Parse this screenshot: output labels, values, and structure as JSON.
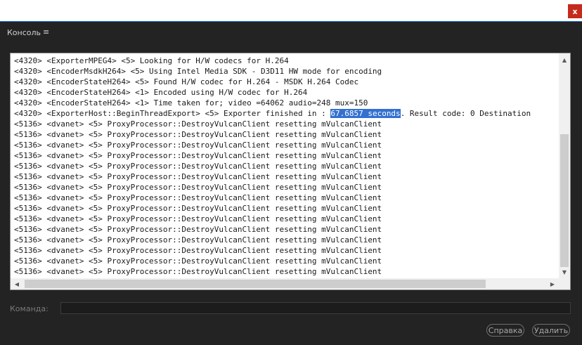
{
  "window": {
    "close_label": "x"
  },
  "panel": {
    "title": "Консоль",
    "menu_icon": "≡"
  },
  "console": {
    "lines": [
      "<4320> <ExporterMPEG4> <5> Looking for H/W codecs for H.264",
      "<4320> <EncoderMsdkH264> <5> Using Intel Media SDK - D3D11 HW mode for encoding",
      "<4320> <EncoderStateH264> <5> Found H/W codec for H.264 - MSDK H.264 Codec",
      "<4320> <EncoderStateH264> <1> Encoded using H/W codec for H.264",
      "<4320> <EncoderStateH264> <1> Time taken for; video =64062 audio=248 mux=150",
      "<4320> <ExporterHost::BeginThreadExport> <5> Exporter finished in : 67.6857 seconds. Result code: 0 Destination",
      "<5136> <dvanet> <5> ProxyProcessor::DestroyVulcanClient resetting mVulcanClient",
      "<5136> <dvanet> <5> ProxyProcessor::DestroyVulcanClient resetting mVulcanClient",
      "<5136> <dvanet> <5> ProxyProcessor::DestroyVulcanClient resetting mVulcanClient",
      "<5136> <dvanet> <5> ProxyProcessor::DestroyVulcanClient resetting mVulcanClient",
      "<5136> <dvanet> <5> ProxyProcessor::DestroyVulcanClient resetting mVulcanClient",
      "<5136> <dvanet> <5> ProxyProcessor::DestroyVulcanClient resetting mVulcanClient",
      "<5136> <dvanet> <5> ProxyProcessor::DestroyVulcanClient resetting mVulcanClient",
      "<5136> <dvanet> <5> ProxyProcessor::DestroyVulcanClient resetting mVulcanClient",
      "<5136> <dvanet> <5> ProxyProcessor::DestroyVulcanClient resetting mVulcanClient",
      "<5136> <dvanet> <5> ProxyProcessor::DestroyVulcanClient resetting mVulcanClient",
      "<5136> <dvanet> <5> ProxyProcessor::DestroyVulcanClient resetting mVulcanClient",
      "<5136> <dvanet> <5> ProxyProcessor::DestroyVulcanClient resetting mVulcanClient",
      "<5136> <dvanet> <5> ProxyProcessor::DestroyVulcanClient resetting mVulcanClient",
      "<5136> <dvanet> <5> ProxyProcessor::DestroyVulcanClient resetting mVulcanClient",
      "<5136> <dvanet> <5> ProxyProcessor::DestroyVulcanClient resetting mVulcanClient"
    ],
    "selection": {
      "line": 5,
      "text": "67.6857 seconds"
    }
  },
  "command": {
    "label": "Команда:",
    "value": ""
  },
  "buttons": {
    "help": "Справка",
    "delete": "Удалить"
  },
  "colors": {
    "selection": "#3370d0",
    "accent_line": "#1473e6",
    "close": "#c42b1c"
  }
}
